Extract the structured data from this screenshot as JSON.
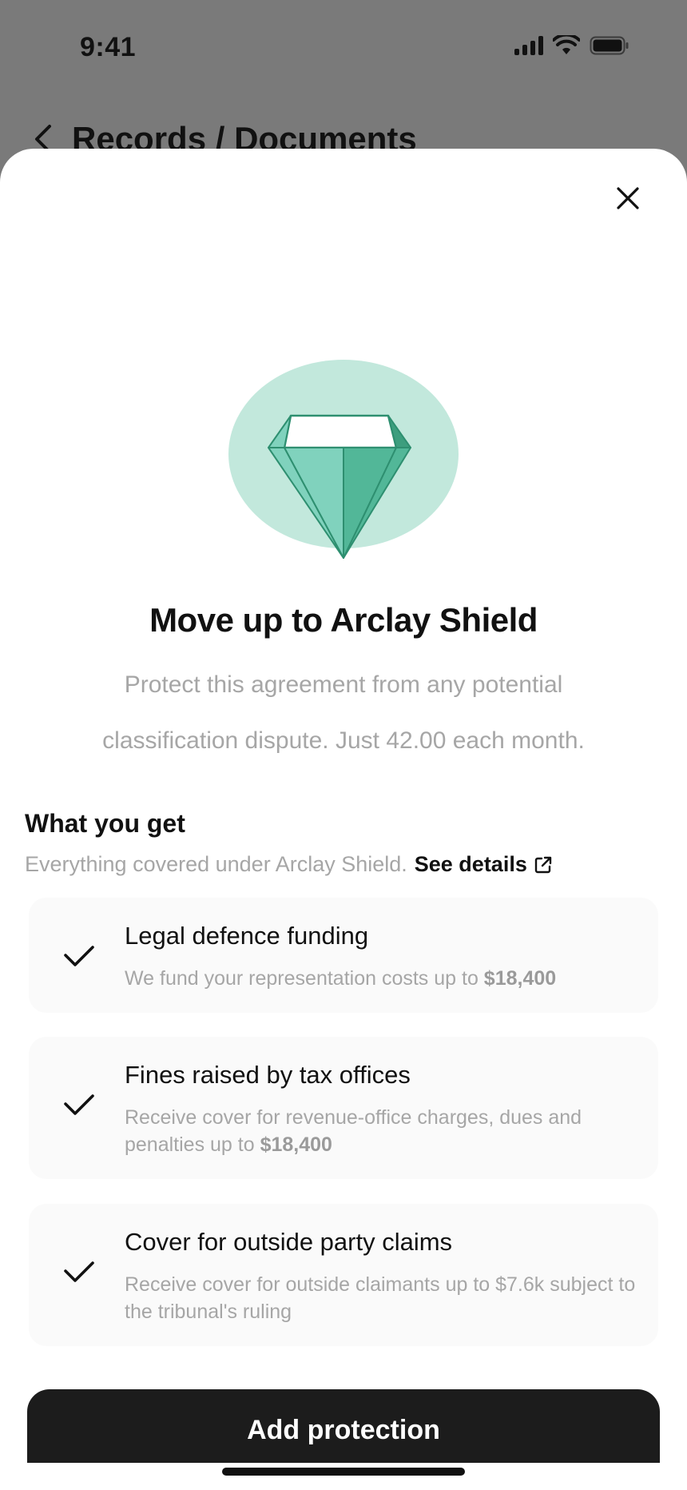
{
  "status": {
    "time": "9:41"
  },
  "background": {
    "nav_title": "Records / Documents"
  },
  "modal": {
    "headline": "Move up to Arclay Shield",
    "subtitle_line1": "Protect this agreement from any potential",
    "subtitle_line2": "classification dispute. Just 42.00 each month.",
    "section_title": "What you get",
    "section_sub": "Everything covered under Arclay Shield.",
    "details_link": "See details",
    "benefits": [
      {
        "title": "Legal defence funding",
        "desc": "We fund your representation costs up to ",
        "amount": "$18,400"
      },
      {
        "title": "Fines raised by tax offices",
        "desc": "Receive cover for revenue-office charges, dues and penalties up to ",
        "amount": "$18,400"
      },
      {
        "title": "Cover for outside party claims",
        "desc": "Receive cover for outside claimants up to $7.6k subject to the tribunal's ruling",
        "amount": ""
      }
    ],
    "cta_label": "Add protection"
  },
  "icons": {
    "back": "chevron-left-icon",
    "close": "close-icon",
    "gem": "diamond-icon",
    "check": "checkmark-icon",
    "external": "external-link-icon"
  },
  "colors": {
    "gem_bg": "#c2e8dc",
    "gem_light": "#80d2bd",
    "gem_mid": "#52b798",
    "gem_stroke": "#2e8f70",
    "cta_bg": "#1c1c1c",
    "card_bg": "#fafafa"
  }
}
